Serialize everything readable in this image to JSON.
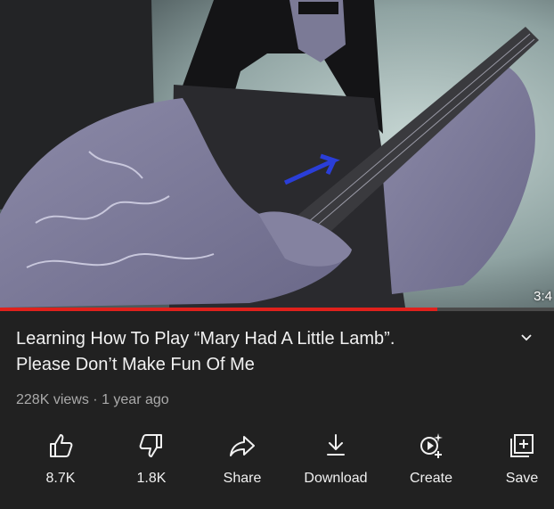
{
  "video": {
    "duration": "3:4",
    "progress_percent": 79
  },
  "info": {
    "title_line1": "Learning How To Play “Mary Had A Little Lamb”.",
    "title_line2": "Please Don’t Make Fun Of Me",
    "views": "228K views",
    "separator": "·",
    "age": "1 year ago"
  },
  "actions": {
    "like": "8.7K",
    "dislike": "1.8K",
    "share": "Share",
    "download": "Download",
    "create": "Create",
    "save": "Save"
  },
  "colors": {
    "background": "#212121",
    "progress": "#e0211c",
    "secondary_text": "#aaaaaa"
  },
  "icons": [
    "thumbs-up-icon",
    "thumbs-down-icon",
    "share-arrow-icon",
    "download-icon",
    "create-sparkle-icon",
    "save-playlist-icon",
    "chevron-down-icon"
  ]
}
